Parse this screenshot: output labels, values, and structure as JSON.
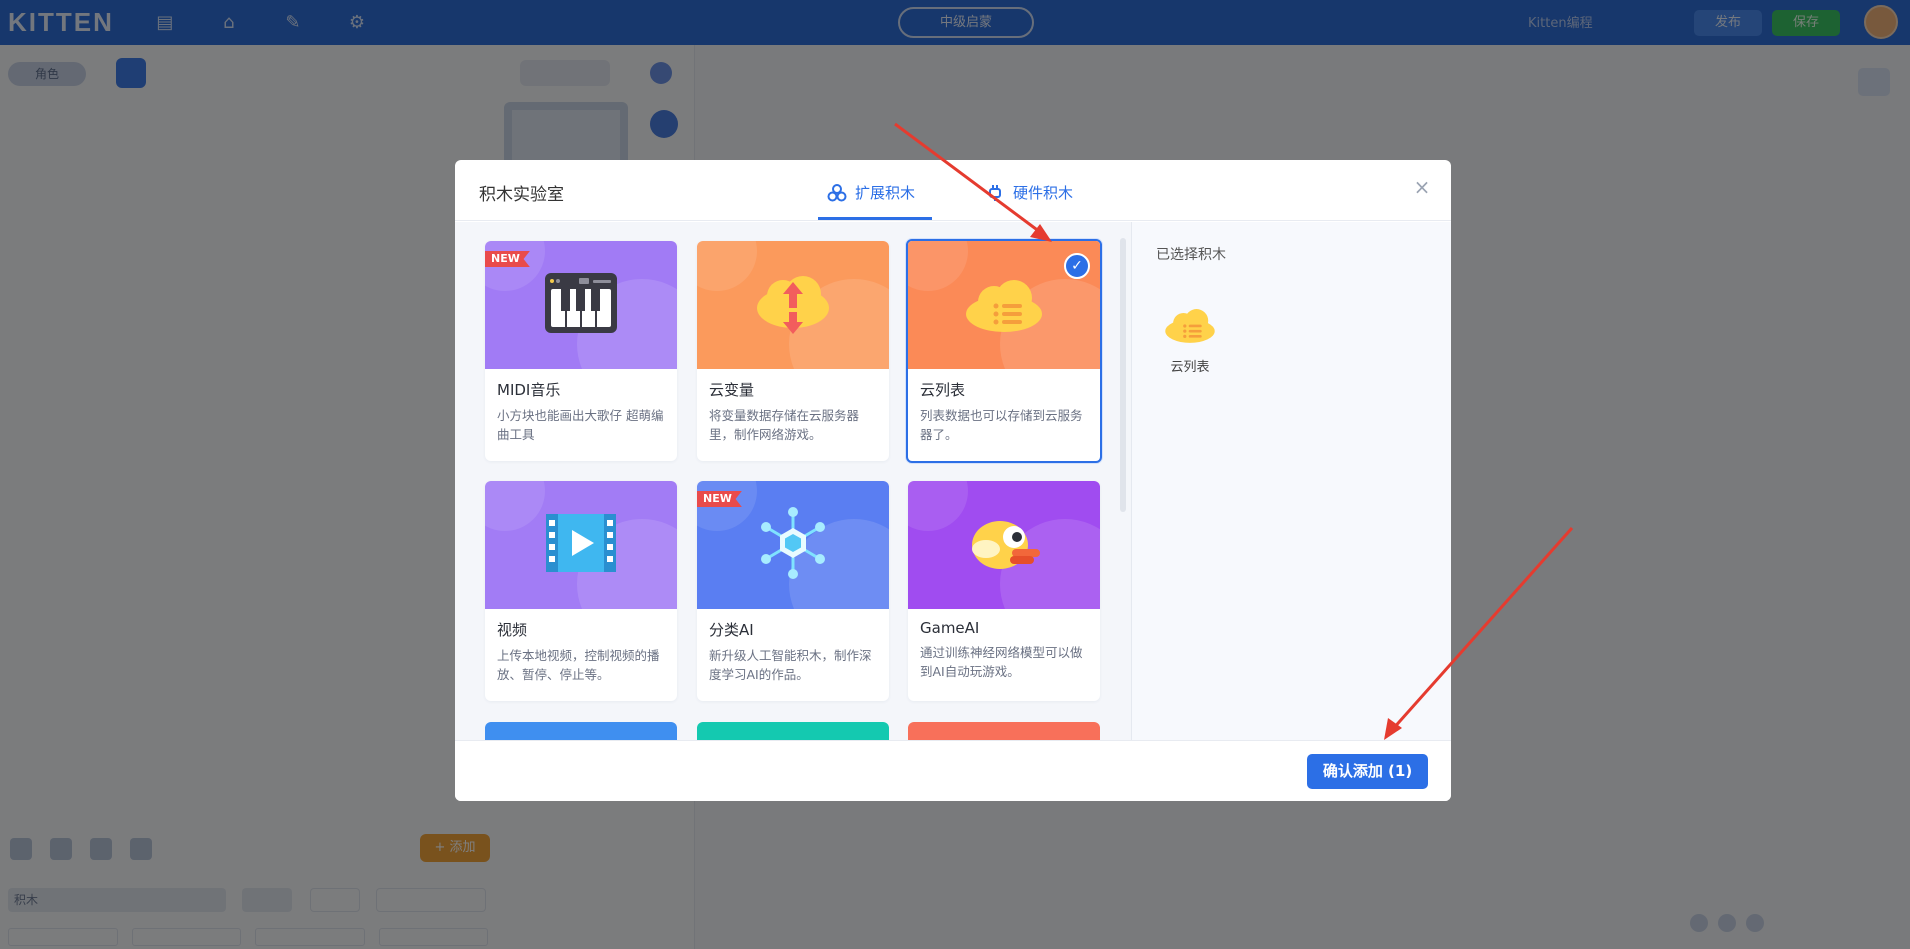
{
  "app": {
    "logo": "KITTEN",
    "project_label": "中级启蒙",
    "user_label": "Kitten编程",
    "btn_share": "发布",
    "btn_save": "保存"
  },
  "left_panel": {
    "chip": "角色",
    "search_value": "积木",
    "add_button": "+ 添加"
  },
  "modal": {
    "title": "积木实验室",
    "tabs": [
      {
        "label": "扩展积木",
        "icon": "blocks-icon",
        "active": true
      },
      {
        "label": "硬件积木",
        "icon": "plug-icon",
        "active": false
      }
    ],
    "close_label": "×",
    "selected_title": "已选择积木",
    "selected_items": [
      {
        "label": "云列表",
        "icon": "cloud-list-icon"
      }
    ],
    "confirm_label": "确认添加 (1)",
    "cards": [
      {
        "name": "MIDI音乐",
        "desc": "小方块也能画出大歌仔 超萌编曲工具",
        "badge": "NEW",
        "color": "#a17bf5",
        "icon": "piano-icon",
        "selected": false
      },
      {
        "name": "云变量",
        "desc": "将变量数据存储在云服务器里，制作网络游戏。",
        "badge": "",
        "color": "#fb9a5c",
        "icon": "cloud-upload-icon",
        "selected": false
      },
      {
        "name": "云列表",
        "desc": "列表数据也可以存储到云服务器了。",
        "badge": "",
        "color": "#fb8a57",
        "icon": "cloud-list-icon",
        "selected": true
      },
      {
        "name": "视频",
        "desc": "上传本地视频，控制视频的播放、暂停、停止等。",
        "badge": "",
        "color": "#a27cf5",
        "icon": "video-icon",
        "selected": false
      },
      {
        "name": "分类AI",
        "desc": "新升级人工智能积木，制作深度学习AI的作品。",
        "badge": "NEW",
        "color": "#5a7ef2",
        "icon": "neural-icon",
        "selected": false
      },
      {
        "name": "GameAI",
        "desc": "通过训练神经网络模型可以做到AI自动玩游戏。",
        "badge": "",
        "color": "#a04cf0",
        "icon": "bird-icon",
        "selected": false
      }
    ],
    "partial_card_colors": [
      "#3f8ff0",
      "#14c9b0",
      "#f8705a"
    ]
  },
  "colors": {
    "accent": "#2c6fe6",
    "annotation_arrow": "#e53b2f"
  }
}
